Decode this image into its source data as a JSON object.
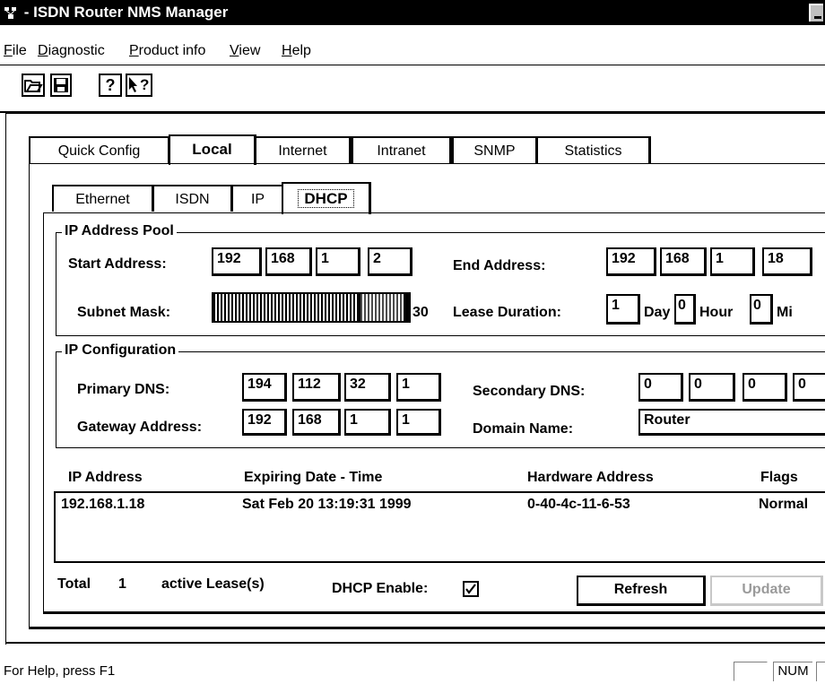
{
  "window": {
    "title": " - ISDN Router NMS Manager"
  },
  "menu": [
    {
      "label": "File",
      "u": "F"
    },
    {
      "label": "Diagnostic",
      "u": "D"
    },
    {
      "label": "Product info",
      "u": "P"
    },
    {
      "label": "View",
      "u": "V"
    },
    {
      "label": "Help",
      "u": "H"
    }
  ],
  "toolbar": {
    "buttons": [
      "open-icon",
      "save-icon",
      "help-icon",
      "context-help-icon"
    ]
  },
  "main_tabs": [
    "Quick Config",
    "Local",
    "Internet",
    "Intranet",
    "SNMP",
    "Statistics"
  ],
  "sub_tabs": [
    "Ethernet",
    "ISDN",
    "IP",
    "DHCP"
  ],
  "ip_pool": {
    "title": "IP Address Pool",
    "start_label": "Start Address:",
    "start": [
      "192",
      "168",
      "1",
      "2"
    ],
    "end_label": "End Address:",
    "end": [
      "192",
      "168",
      "1",
      "18"
    ],
    "mask_label": "Subnet Mask:",
    "mask_value": "30",
    "lease_label": "Lease Duration:",
    "lease_day": "1",
    "day_label": "Day",
    "lease_hour": "0",
    "hour_label": "Hour",
    "lease_min": "0",
    "min_label": "Mi"
  },
  "ip_config": {
    "title": "IP Configuration",
    "primary_label": "Primary DNS:",
    "primary": [
      "194",
      "112",
      "32",
      "1"
    ],
    "secondary_label": "Secondary DNS:",
    "secondary": [
      "0",
      "0",
      "0",
      "0"
    ],
    "gateway_label": "Gateway Address:",
    "gateway": [
      "192",
      "168",
      "1",
      "1"
    ],
    "domain_label": "Domain Name:",
    "domain": "Router"
  },
  "lease_table": {
    "headers": [
      "IP Address",
      "Expiring Date - Time",
      "Hardware Address",
      "Flags"
    ],
    "rows": [
      [
        "192.168.1.18",
        "Sat Feb 20 13:19:31 1999",
        "0-40-4c-11-6-53",
        "Normal"
      ]
    ]
  },
  "footer": {
    "total_label": "Total",
    "total_count": "1",
    "active_label": "active Lease(s)",
    "dhcp_enable_label": "DHCP Enable:",
    "dhcp_enabled": "checked",
    "refresh_label": "Refresh",
    "update_label": "Update"
  },
  "status": {
    "help_text": "For Help, press F1",
    "num_label": "NUM"
  }
}
